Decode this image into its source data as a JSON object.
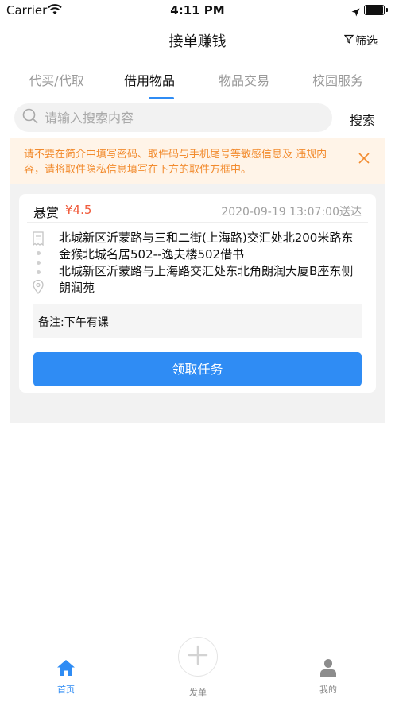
{
  "status_bar": {
    "carrier": "Carrier",
    "time": "4:11 PM"
  },
  "nav": {
    "title": "接单赚钱",
    "filter_label": "筛选"
  },
  "tabs": [
    {
      "label": "代买/代取"
    },
    {
      "label": "借用物品"
    },
    {
      "label": "物品交易"
    },
    {
      "label": "校园服务"
    }
  ],
  "search": {
    "placeholder": "请输入搜索内容",
    "value": "",
    "button_label": "搜索"
  },
  "notice": {
    "text": "请不要在简介中填写密码、取件码与手机尾号等敏感信息及 违规内容，请将取件隐私信息填写在下方的取件方框中。"
  },
  "order": {
    "reward_label": "悬赏",
    "reward_amount": "¥4.5",
    "deliver_time": "2020-09-19 13:07:00送达",
    "from_address": "北城新区沂蒙路与三和二街(上海路)交汇处北200米路东金猴北城名居502--逸夫楼502借书",
    "to_address": "北城新区沂蒙路与上海路交汇处东北角朗润大厦B座东侧朗润苑",
    "remark": "备注:下午有课",
    "accept_label": "领取任务"
  },
  "tabbar": {
    "home_label": "首页",
    "post_label": "发单",
    "mine_label": "我的"
  },
  "colors": {
    "accent": "#2f8cf4",
    "price": "#f05a3a",
    "notice_text": "#f28b2e",
    "notice_bg": "#fff4e8"
  }
}
